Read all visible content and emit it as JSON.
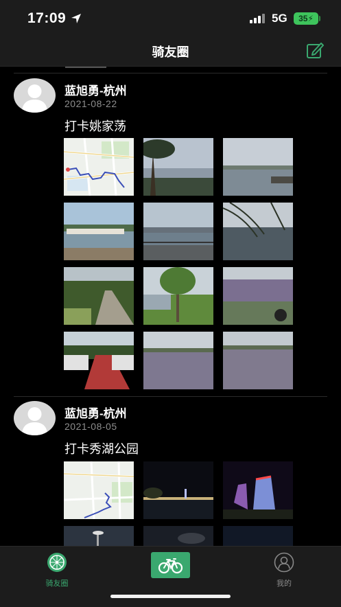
{
  "status_bar": {
    "time": "17:09",
    "network": "5G",
    "battery": "35"
  },
  "nav": {
    "title": "骑友圈",
    "compose_icon": "compose-icon"
  },
  "posts": [
    {
      "user": "蓝旭勇-杭州",
      "date": "2021-08-22",
      "text": "打卡姚家荡"
    },
    {
      "user": "蓝旭勇-杭州",
      "date": "2021-08-05",
      "text": "打卡秀湖公园"
    }
  ],
  "tabbar": {
    "items": [
      {
        "label": "骑友圈",
        "icon": "wheel-icon",
        "active": true,
        "color": "#3aa86f"
      },
      {
        "label": "",
        "icon": "bike-icon",
        "color": "#3aa86f"
      },
      {
        "label": "我的",
        "icon": "user-icon",
        "color": "#777777"
      }
    ]
  },
  "colors": {
    "accent": "#3aa86f",
    "bar_bg": "#1c1c1c",
    "background": "#000000"
  }
}
